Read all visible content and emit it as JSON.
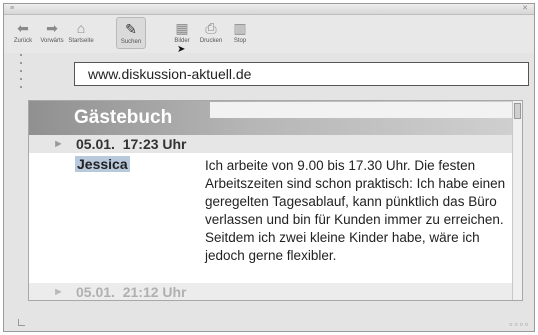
{
  "toolbar": {
    "items": [
      {
        "label": "Zurück",
        "icon": "back-arrow-icon",
        "glyph": "⬅"
      },
      {
        "label": "Vorwärts",
        "icon": "forward-arrow-icon",
        "glyph": "➡"
      },
      {
        "label": "Startseite",
        "icon": "home-icon",
        "glyph": "⌂"
      },
      {
        "label": "Suchen",
        "icon": "search-icon",
        "glyph": "✎"
      },
      {
        "label": "Bilder",
        "icon": "images-icon",
        "glyph": "▦"
      },
      {
        "label": "Drucken",
        "icon": "print-icon",
        "glyph": "⎙"
      },
      {
        "label": "Stop",
        "icon": "stop-icon",
        "glyph": "▥"
      }
    ]
  },
  "address": {
    "url": "www.diskussion-aktuell.de"
  },
  "page": {
    "title": "Gästebuch",
    "entries": [
      {
        "date": "05.01.  17:23 Uhr",
        "author": "Jessica",
        "message": "Ich arbeite von 9.00 bis 17.30 Uhr. Die festen Arbeitszeiten sind schon praktisch: Ich habe einen geregelten Tagesablauf, kann pünktlich das Büro verlassen und bin für Kunden immer zu erreichen. Seitdem ich zwei kleine Kinder habe, wäre ich jedoch gerne flexibler."
      },
      {
        "date": "05.01.  21:12 Uhr"
      }
    ]
  }
}
